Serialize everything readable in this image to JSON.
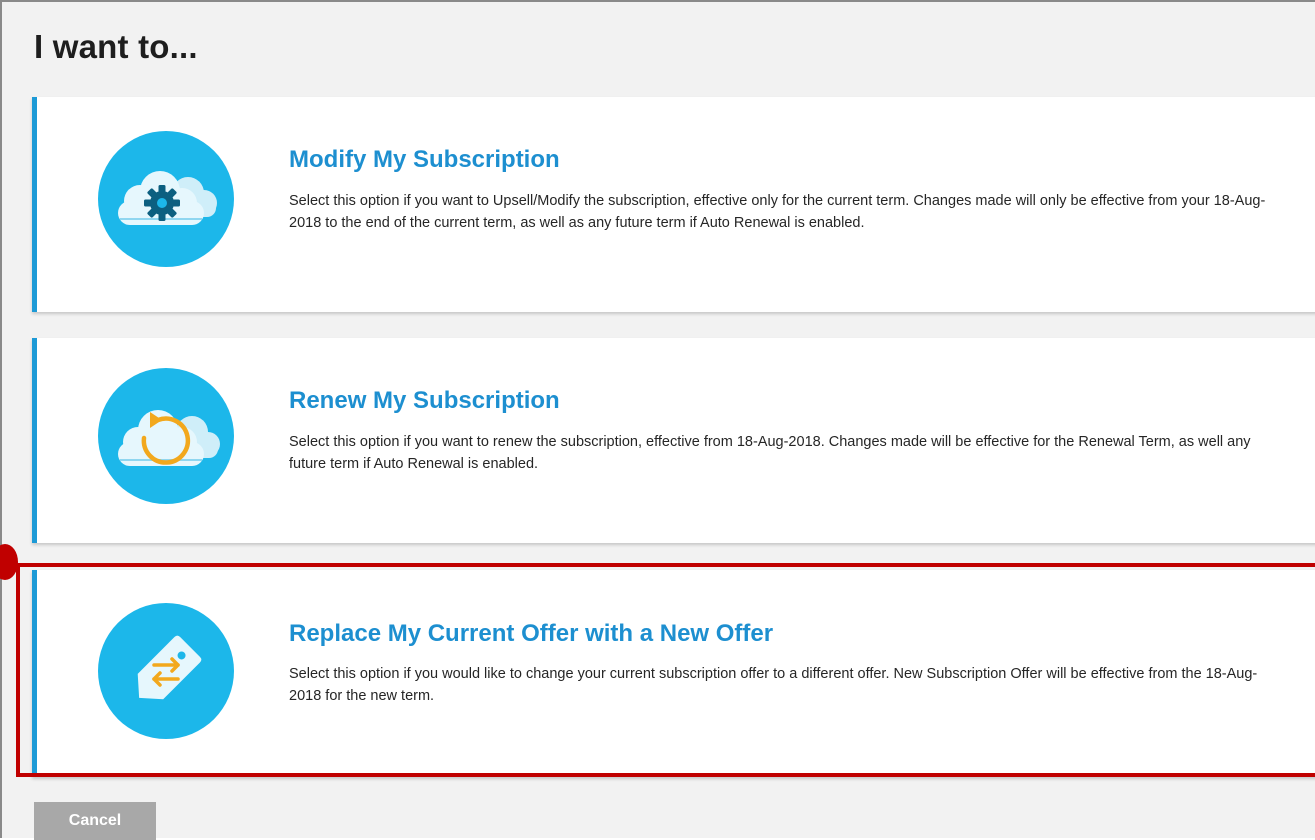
{
  "page": {
    "heading": "I want to..."
  },
  "options": [
    {
      "title": "Modify My Subscription",
      "description": "Select this option if you want to Upsell/Modify the subscription, effective only for the current term. Changes made will only be effective from your 18-Aug-2018 to the end of the current term, as well as any future term if Auto Renewal is enabled.",
      "icon": "cloud-gear-icon"
    },
    {
      "title": "Renew My Subscription",
      "description": "Select this option if you want to renew the subscription, effective from 18-Aug-2018. Changes made will be effective for the Renewal Term, as well any future term if Auto Renewal is enabled.",
      "icon": "cloud-renew-icon"
    },
    {
      "title": "Replace My Current Offer with a New Offer",
      "description": "Select this option if you would like to change your current subscription offer to a different offer. New Subscription Offer will be effective from the 18-Aug-2018 for the new term.",
      "icon": "tag-swap-icon"
    }
  ],
  "footer": {
    "cancel_label": "Cancel"
  },
  "colors": {
    "accent": "#1d9ad6",
    "title": "#1d8fd0",
    "icon_bg": "#1cb7ea",
    "highlight": "#c00000",
    "cancel_bg": "#a8a8a8"
  }
}
